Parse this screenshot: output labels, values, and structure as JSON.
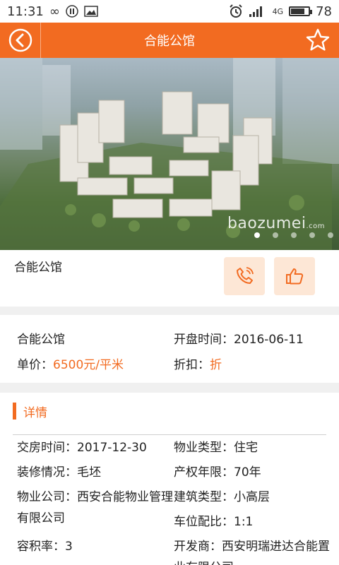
{
  "status_bar": {
    "time": "11:31",
    "network": "4G",
    "battery": "78",
    "battery_level": 0.78
  },
  "header": {
    "title": "合能公馆",
    "back_icon": "back-arrow-icon",
    "fav_icon": "star-icon",
    "accent_color": "#f26b21"
  },
  "banner": {
    "watermark": "baozumei",
    "watermark_suffix": ".com",
    "slides": 5,
    "active_slide": 0
  },
  "property": {
    "name": "合能公馆",
    "phone_icon": "phone-icon",
    "like_icon": "thumbs-up-icon"
  },
  "summary": {
    "name": "合能公馆",
    "open_label": "开盘时间：",
    "open_value": "2016-06-11",
    "price_label": "单价：",
    "price_value": "6500元/平米",
    "discount_label": "折扣：",
    "discount_value": "折"
  },
  "details": {
    "section_title": "详情",
    "items": [
      {
        "label": "交房时间：",
        "value": "2017-12-30"
      },
      {
        "label": "物业类型：",
        "value": "住宅"
      },
      {
        "label": "装修情况：",
        "value": "毛坯"
      },
      {
        "label": "产权年限：",
        "value": "70年"
      },
      {
        "label": "物业公司：",
        "value": "西安合能物业管理有限公司"
      },
      {
        "label": "建筑类型：",
        "value": "小高层"
      },
      {
        "label": "车位配比：",
        "value": "1:1"
      },
      {
        "label": "容积率：",
        "value": "3"
      },
      {
        "label": "开发商：",
        "value": "西安明瑞进达合能置业有限公司"
      }
    ]
  }
}
